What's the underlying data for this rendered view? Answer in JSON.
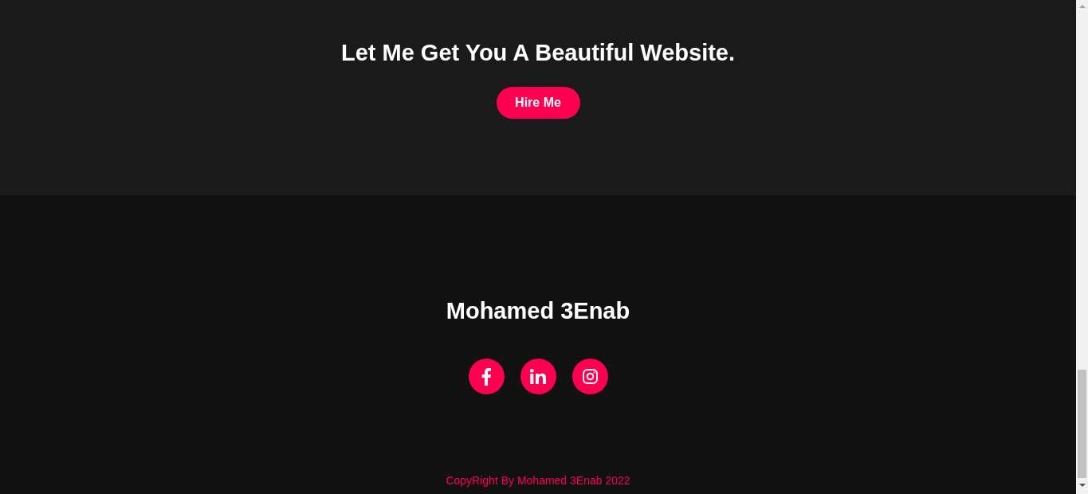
{
  "cta": {
    "heading": "Let Me Get You A Beautiful Website.",
    "button": "Hire Me"
  },
  "footer": {
    "name": "Mohamed 3Enab",
    "social": [
      {
        "kind": "facebook"
      },
      {
        "kind": "linkedin"
      },
      {
        "kind": "instagram"
      }
    ],
    "copyright": "CopyRight By Mohamed 3Enab 2022"
  }
}
